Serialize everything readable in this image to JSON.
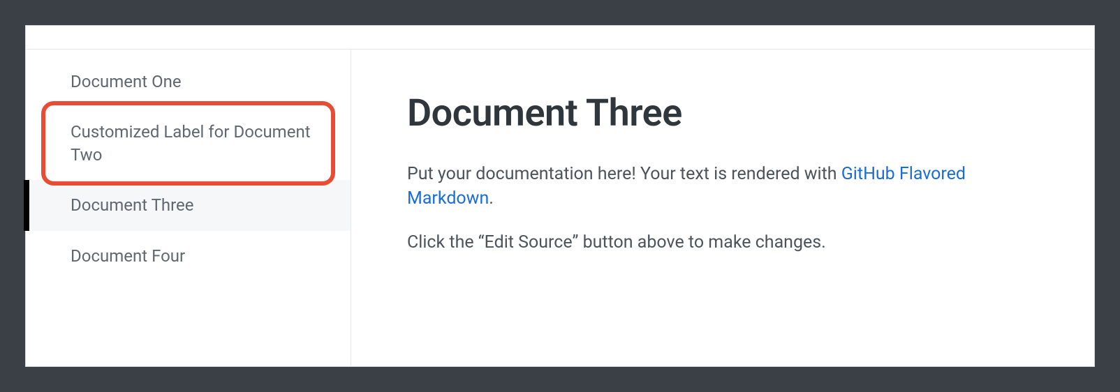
{
  "sidebar": {
    "items": [
      {
        "label": "Document One",
        "selected": false,
        "highlighted": false
      },
      {
        "label": "Customized Label for Document Two",
        "selected": false,
        "highlighted": true
      },
      {
        "label": "Document Three",
        "selected": true,
        "highlighted": false
      },
      {
        "label": "Document Four",
        "selected": false,
        "highlighted": false
      }
    ]
  },
  "content": {
    "title": "Document Three",
    "paragraph1_before_link": "Put your documentation here! Your text is rendered with ",
    "link_text": "GitHub Flavored Markdown",
    "paragraph1_after_link": ".",
    "paragraph2": "Click the “Edit Source” button above to make changes."
  }
}
